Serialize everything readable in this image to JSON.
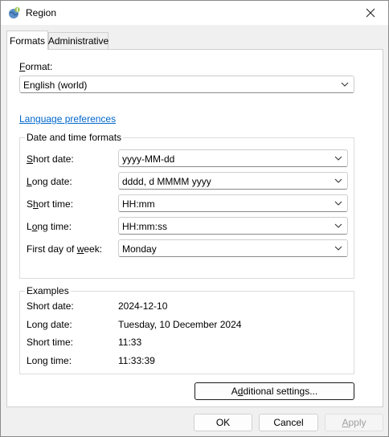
{
  "window": {
    "title": "Region"
  },
  "tabs": [
    {
      "label": "Formats",
      "active": true
    },
    {
      "label": "Administrative",
      "active": false
    }
  ],
  "format": {
    "label": "Format:",
    "label_mnemonic": "F",
    "label_rest": "ormat:",
    "value": "English (world)"
  },
  "language_preferences_link": "Language preferences",
  "date_time_formats": {
    "title": "Date and time formats",
    "rows": [
      {
        "label": "Short date:",
        "mn": "S",
        "rest": "hort date:",
        "value": "yyyy-MM-dd"
      },
      {
        "label": "Long date:",
        "mn": "L",
        "rest": "ong date:",
        "value": "dddd, d MMMM yyyy"
      },
      {
        "label": "Short time:",
        "mn": "h",
        "pre": "S",
        "rest": "ort time:",
        "value": "HH:mm"
      },
      {
        "label": "Long time:",
        "mn": "o",
        "pre": "L",
        "rest": "ng time:",
        "value": "HH:mm:ss"
      },
      {
        "label": "First day of week:",
        "pre": "First day of ",
        "mn": "w",
        "rest": "eek:",
        "value": "Monday"
      }
    ]
  },
  "examples": {
    "title": "Examples",
    "rows": [
      {
        "label": "Short date:",
        "value": "2024-12-10"
      },
      {
        "label": "Long date:",
        "value": "Tuesday, 10 December 2024"
      },
      {
        "label": "Short time:",
        "value": "11:33"
      },
      {
        "label": "Long time:",
        "value": "11:33:39"
      }
    ]
  },
  "buttons": {
    "additional_settings": "Additional settings...",
    "additional_settings_pre": "A",
    "additional_settings_mn": "d",
    "additional_settings_rest": "ditional settings...",
    "ok": "OK",
    "cancel": "Cancel",
    "apply": "Apply",
    "apply_mn": "A",
    "apply_rest": "pply"
  },
  "colors": {
    "link": "#0066cc",
    "window_bg": "#f0f0f0",
    "panel_bg": "#ffffff"
  },
  "icons": {
    "app": "region-globe-icon",
    "close": "close-icon",
    "dropdown": "chevron-down-icon"
  }
}
